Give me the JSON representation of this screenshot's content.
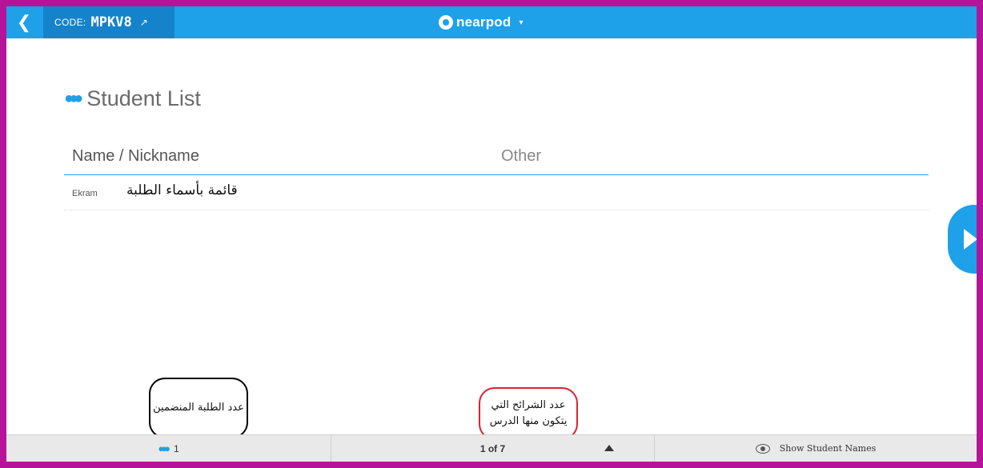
{
  "topbar": {
    "back_icon": "chevron-left-icon",
    "code_label": "CODE:",
    "code_value": "MPKV8",
    "share_icon": "external-link-icon",
    "brand_name": "nearpod",
    "brand_caret": "▾",
    "color": "#1ea1e8"
  },
  "page": {
    "title": "Student List",
    "title_icon": "people-group-icon"
  },
  "table": {
    "columns": [
      "Name / Nickname",
      "Other"
    ],
    "rows": [
      {
        "name": "Ekram",
        "annotation": "قائمة بأسماء الطلبة"
      }
    ]
  },
  "next_button": {
    "icon": "play-triangle-icon"
  },
  "bottombar": {
    "students_icon": "people-group-icon",
    "student_count": "1",
    "slide_position": "1 of 7",
    "expand_icon": "triangle-up-icon",
    "eye_icon": "eye-icon",
    "show_names_label": "Show Student Names"
  },
  "callouts": {
    "students_joined": "عدد الطلبة المنضمين",
    "slides_count_line1": "عدد الشرائح التي",
    "slides_count_line2": "يتكون منها الدرس"
  },
  "colors": {
    "accent": "#1ea1e8",
    "frame": "#b5149a",
    "callout_red": "#e02030"
  }
}
